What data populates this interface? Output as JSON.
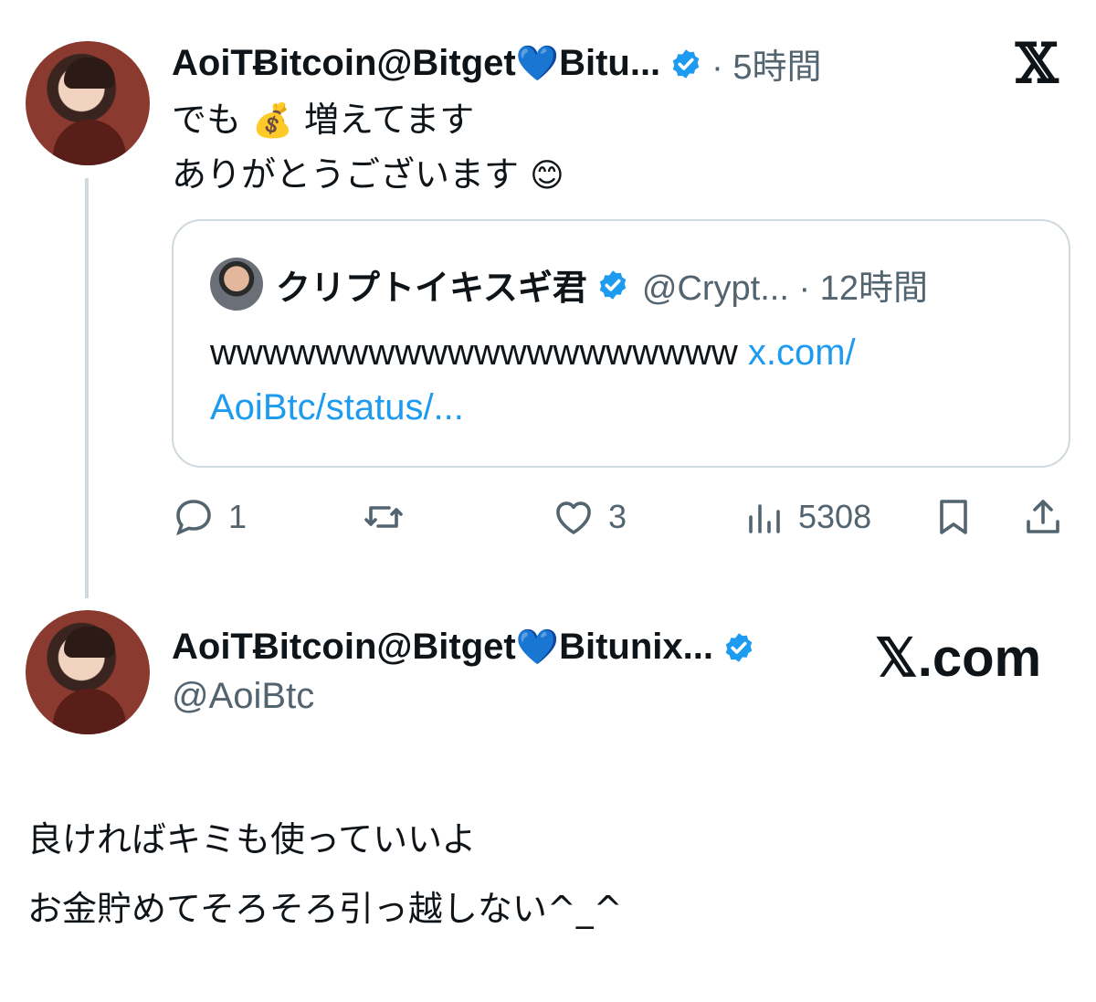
{
  "tweet1": {
    "display_name": "AoiTɃitcoin@Bitget",
    "heart": "💙",
    "display_name_rest": "Bitu...",
    "time": "· 5時間",
    "line1_prefix": "でも",
    "line1_emoji": "💰",
    "line1_suffix": "増えてます",
    "line2_text": "ありがとうございます",
    "line2_emoji": "😊",
    "x_logo": "𝕏"
  },
  "quote": {
    "display_name": "クリプトイキスギ君",
    "handle_time": "@Crypt... · 12時間",
    "text": "wwwwwwwwwwwwwwwwwwww",
    "link_part1": "x.com/",
    "link_part2": "AoiBtc/status/..."
  },
  "actions": {
    "reply_count": "1",
    "retweet_count": "",
    "like_count": "3",
    "views_count": "5308"
  },
  "card2": {
    "display_name": "AoiTɃitcoin@Bitget",
    "heart": "💙",
    "display_name_rest": "Bitunix...",
    "handle": "@AoiBtc",
    "brand": "𝕏.com"
  },
  "body": {
    "line1": "良ければキミも使っていいよ",
    "line2": "お金貯めてそろそろ引っ越しない^_^"
  },
  "colors": {
    "verified": "#1d9bf0",
    "link": "#1d9bf0",
    "muted": "#536471",
    "border": "#cfd9de"
  }
}
